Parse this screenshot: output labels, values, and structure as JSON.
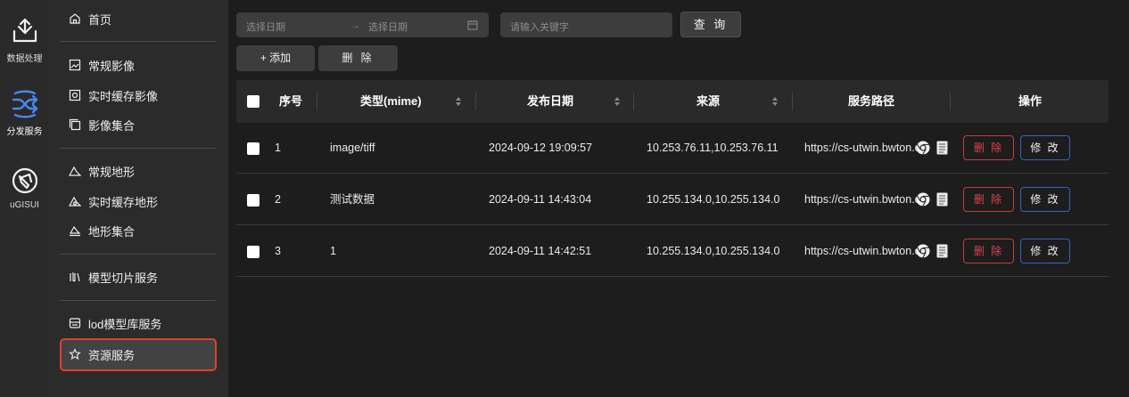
{
  "rail": {
    "items": [
      {
        "label": "数据处理",
        "icon": "data-processing-icon"
      },
      {
        "label": "分发服务",
        "icon": "distribution-icon",
        "active": true
      },
      {
        "label": "uGISUI",
        "icon": "ugis-icon"
      }
    ]
  },
  "menu": {
    "items": [
      {
        "label": "首页",
        "icon": "home-icon"
      },
      {
        "label": "常规影像",
        "icon": "image-icon"
      },
      {
        "label": "实时缓存影像",
        "icon": "image-cache-icon"
      },
      {
        "label": "影像集合",
        "icon": "collection-icon"
      },
      {
        "label": "常规地形",
        "icon": "terrain-icon"
      },
      {
        "label": "实时缓存地形",
        "icon": "terrain-cache-icon"
      },
      {
        "label": "地形集合",
        "icon": "terrain-collection-icon"
      },
      {
        "label": "模型切片服务",
        "icon": "model-tile-icon"
      },
      {
        "label": "lod模型库服务",
        "icon": "lod-model-icon"
      },
      {
        "label": "资源服务",
        "icon": "resource-icon",
        "selected": true
      }
    ]
  },
  "filters": {
    "start_placeholder": "选择日期",
    "end_placeholder": "选择日期",
    "keyword_placeholder": "请输入关键字",
    "query_label": "查 询"
  },
  "actions": {
    "add_label": "+ 添加",
    "delete_label": "删 除"
  },
  "table": {
    "headers": {
      "index": "序号",
      "type": "类型(mime)",
      "date": "发布日期",
      "source": "来源",
      "path": "服务路径",
      "ops": "操作"
    },
    "rows": [
      {
        "index": "1",
        "type": "image/tiff",
        "date": "2024-09-12 19:09:57",
        "source": "10.253.76.11,10.253.76.11",
        "path": "https://cs-utwin.bwton.com"
      },
      {
        "index": "2",
        "type": "测试数据",
        "date": "2024-09-11 14:43:04",
        "source": "10.255.134.0,10.255.134.0",
        "path": "https://cs-utwin.bwton.com"
      },
      {
        "index": "3",
        "type": "1",
        "date": "2024-09-11 14:42:51",
        "source": "10.255.134.0,10.255.134.0",
        "path": "https://cs-utwin.bwton.com"
      }
    ],
    "row_delete_label": "删 除",
    "row_edit_label": "修 改"
  },
  "colors": {
    "accent_blue": "#3b5fc0",
    "danger_red": "#d9434f",
    "selection_outline": "#e0402a"
  }
}
